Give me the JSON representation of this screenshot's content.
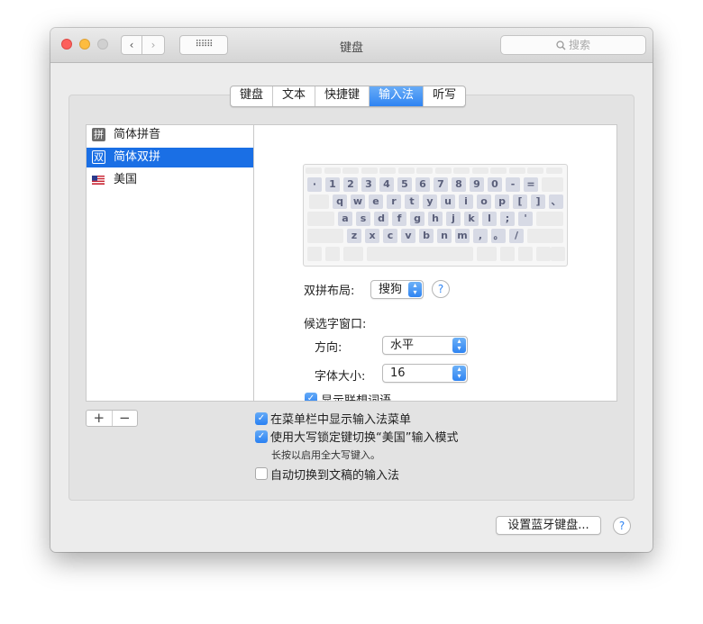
{
  "window": {
    "title": "键盘",
    "search_placeholder": "搜索",
    "nav": {
      "back": "‹",
      "forward": "›",
      "grid": "⠿⠿⠿"
    }
  },
  "tabs": [
    {
      "label": "键盘",
      "active": false
    },
    {
      "label": "文本",
      "active": false
    },
    {
      "label": "快捷键",
      "active": false
    },
    {
      "label": "输入法",
      "active": true
    },
    {
      "label": "听写",
      "active": false
    }
  ],
  "sources": [
    {
      "badge": "拼",
      "label": "简体拼音",
      "selected": false
    },
    {
      "badge": "双",
      "label": "简体双拼",
      "selected": true
    },
    {
      "flag": "us-flag",
      "label": "美国",
      "selected": false
    }
  ],
  "keyboard": {
    "row1": [
      "·",
      "1",
      "2",
      "3",
      "4",
      "5",
      "6",
      "7",
      "8",
      "9",
      "0",
      "-",
      "="
    ],
    "row2": [
      "q",
      "w",
      "e",
      "r",
      "t",
      "y",
      "u",
      "i",
      "o",
      "p",
      "[",
      "]",
      "、"
    ],
    "row3": [
      "a",
      "s",
      "d",
      "f",
      "g",
      "h",
      "j",
      "k",
      "l",
      ";",
      "'"
    ],
    "row4": [
      "z",
      "x",
      "c",
      "v",
      "b",
      "n",
      "m",
      ",",
      "。",
      "/"
    ]
  },
  "settings": {
    "layout_label": "双拼布局:",
    "layout_value": "搜狗",
    "candidate_label": "候选字窗口:",
    "direction_label": "方向:",
    "direction_value": "水平",
    "font_size_label": "字体大小:",
    "font_size_value": "16",
    "cut_option": "显示联想词语",
    "help": "?"
  },
  "list_controls": {
    "add": "+",
    "remove": "−"
  },
  "options": [
    {
      "label": "在菜单栏中显示输入法菜单",
      "checked": true
    },
    {
      "label": "使用大写锁定键切换“美国”输入模式",
      "checked": true
    },
    {
      "label": "自动切换到文稿的输入法",
      "checked": false
    }
  ],
  "capslock_note": "长按以启用全大写键入。",
  "bluetooth_button": "设置蓝牙键盘...",
  "help_button": "?",
  "colors": {
    "accent": "#2f84f2",
    "selection": "#1a6fe5",
    "key": "#d7dae5"
  }
}
